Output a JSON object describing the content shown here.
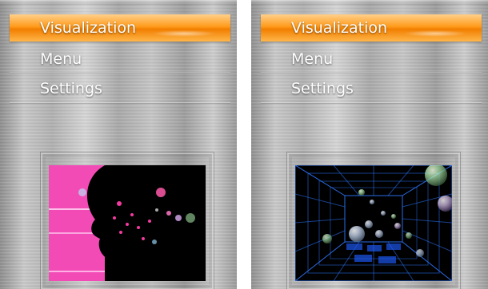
{
  "panels": [
    {
      "menu": {
        "items": [
          {
            "label": "Visualization",
            "selected": true
          },
          {
            "label": "Menu",
            "selected": false
          },
          {
            "label": "Settings",
            "selected": false
          }
        ]
      },
      "preview": {
        "kind": "silhouette-visualization"
      }
    },
    {
      "menu": {
        "items": [
          {
            "label": "Visualization",
            "selected": true
          },
          {
            "label": "Menu",
            "selected": false
          },
          {
            "label": "Settings",
            "selected": false
          }
        ]
      },
      "preview": {
        "kind": "spheres-grid-visualization"
      }
    }
  ],
  "colors": {
    "selected_highlight": "#ff9b1b",
    "text": "#ffffff",
    "metal_base": "#bdbdbd",
    "silhouette_pink": "#ff4fbf",
    "grid_blue": "#2f78ff"
  }
}
